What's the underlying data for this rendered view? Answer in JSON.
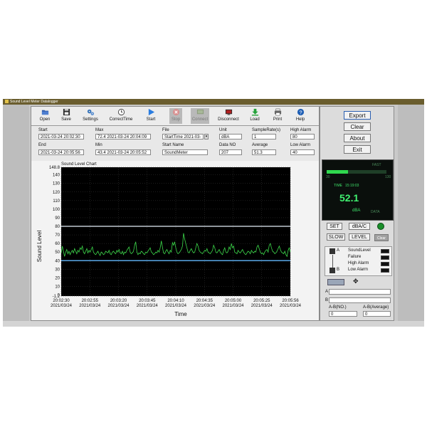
{
  "window": {
    "title": "Sound Level Meter Datalogger"
  },
  "toolbar": [
    {
      "label": "Open",
      "icon": "folder-icon"
    },
    {
      "label": "Save",
      "icon": "floppy-icon"
    },
    {
      "label": "Settings",
      "icon": "gears-icon"
    },
    {
      "label": "CorrectTime",
      "icon": "clock-icon"
    },
    {
      "label": "Start",
      "icon": "play-icon"
    },
    {
      "label": "Stop",
      "icon": "stop-icon",
      "disabled": true
    },
    {
      "label": "Connect",
      "icon": "connect-icon",
      "disabled": true
    },
    {
      "label": "Disconnect",
      "icon": "monitor-icon"
    },
    {
      "label": "Load",
      "icon": "download-arrow-icon"
    },
    {
      "label": "Print",
      "icon": "printer-icon"
    },
    {
      "label": "Help",
      "icon": "help-icon"
    }
  ],
  "info": {
    "start_label": "Start",
    "start_value": "2021-03-24  20:02:30",
    "end_label": "End",
    "end_value": "2021-03-24  20:05:56",
    "max_label": "Max",
    "max_value": "72.4 2021-03-24  20:04:09",
    "min_label": "Min",
    "min_value": "43.4 2021-03-24  20:05:52",
    "file_label": "File",
    "file_value": "StartTime 2021-03-",
    "start_name_label": "Start Name",
    "start_name_value": "SoundMeter",
    "unit_label": "Unit",
    "unit_value": "dBA",
    "data_no_label": "Data NO",
    "data_no_value": "207",
    "sample_rate_label": "SampleRate(s)",
    "sample_rate_value": "1",
    "average_label": "Average",
    "average_value": "51.3",
    "high_alarm_label": "High Alarm",
    "high_alarm_value": "80",
    "low_alarm_label": "Low Alarm",
    "low_alarm_value": "40"
  },
  "side": {
    "export": "Export",
    "clear": "Clear",
    "about": "About",
    "exit": "Exit",
    "set": "SET",
    "dba_c": "dBA/C",
    "slow": "SLOW",
    "level": "LEVEL",
    "clear_small": "Clear"
  },
  "meter": {
    "top_label": "FAST",
    "scale_left": "30",
    "scale_right": "130",
    "time_label": "TIME",
    "time_value": "15:19:03",
    "value": "52.1",
    "unit": "dBA",
    "mode": "DATA"
  },
  "legend": {
    "a_label": "A",
    "b_label": "B",
    "items": [
      {
        "label": "SoundLevel",
        "color": "#2bd84a"
      },
      {
        "label": "Failure",
        "color": "#e03030"
      },
      {
        "label": "High Alarm",
        "color": "#e06a6a"
      },
      {
        "label": "Low Alarm",
        "color": "#5fa8e8"
      }
    ]
  },
  "ab": {
    "a_label": "A",
    "b_label": "B",
    "a_no_label": "A-B(NO.)",
    "a_no_value": "0",
    "a_avg_label": "A-B(Average)",
    "a_avg_value": "0"
  },
  "chart_data": {
    "type": "line",
    "title": "Sound Level Chart",
    "xlabel": "Time",
    "ylabel": "Sound Level",
    "ylim": [
      -1.2,
      148.8
    ],
    "y_ticks": [
      "148.8",
      "140",
      "130",
      "120",
      "110",
      "100",
      "90",
      "80",
      "70",
      "60",
      "50",
      "40",
      "30",
      "20",
      "10",
      "0",
      "-1.2"
    ],
    "x_ticks": [
      {
        "time": "20:02:30",
        "date": "2021/03/24"
      },
      {
        "time": "20:02:55",
        "date": "2021/03/24"
      },
      {
        "time": "20:03:20",
        "date": "2021/03/24"
      },
      {
        "time": "20:03:45",
        "date": "2021/03/24"
      },
      {
        "time": "20:04:10",
        "date": "2021/03/24"
      },
      {
        "time": "20:04:35",
        "date": "2021/03/24"
      },
      {
        "time": "20:05:00",
        "date": "2021/03/24"
      },
      {
        "time": "20:05:25",
        "date": "2021/03/24"
      },
      {
        "time": "20:05:56",
        "date": "2021/03/24"
      }
    ],
    "high_alarm": 80,
    "low_alarm": 40,
    "grid": true,
    "colors": {
      "background": "#000000",
      "line": "#3cd84a",
      "high": "#bfc7cf",
      "low": "#5aa7e6",
      "grid": "#3a3a3a"
    },
    "series": [
      {
        "name": "SoundLevel",
        "values": [
          49,
          57,
          51,
          45,
          50,
          53,
          48,
          51,
          47,
          50,
          52,
          49,
          54,
          51,
          48,
          52,
          50,
          55,
          53,
          57,
          50,
          48,
          51,
          54,
          49,
          52,
          50,
          53,
          56,
          50,
          48,
          47,
          49,
          51,
          48,
          46,
          50,
          49,
          47,
          48,
          51,
          50,
          49,
          52,
          48,
          47,
          50,
          51,
          49,
          48,
          52,
          50,
          53,
          49,
          48,
          51,
          47,
          50,
          49,
          52,
          54,
          56,
          50,
          48,
          49,
          51,
          58,
          62,
          50,
          47,
          49,
          48,
          51,
          50,
          48,
          47,
          50,
          49,
          51,
          53,
          55,
          50,
          49,
          47,
          48,
          50,
          49,
          52,
          50,
          55,
          63,
          56,
          49,
          48,
          51,
          53,
          50,
          48,
          52,
          50,
          61,
          58,
          62,
          55,
          50,
          48,
          49,
          51,
          53,
          57,
          72,
          65,
          60,
          55,
          50,
          49,
          52,
          54,
          51,
          49,
          50,
          55,
          60,
          57,
          52,
          50,
          49,
          48,
          50,
          52,
          51,
          54,
          50,
          49,
          48,
          50,
          52,
          58,
          55,
          50,
          49,
          51,
          53,
          50,
          48,
          47,
          52,
          55,
          50,
          49,
          51,
          56,
          53,
          60,
          55,
          57,
          50,
          49,
          48,
          52,
          50,
          49,
          51,
          53,
          50,
          48,
          47,
          49,
          51,
          50,
          48,
          52,
          50,
          49,
          51,
          50,
          56,
          58,
          54,
          50,
          48,
          49,
          47,
          50,
          52,
          53,
          50,
          58,
          60,
          55,
          51,
          50,
          48,
          49,
          51,
          54,
          57,
          53,
          50,
          49,
          48,
          51,
          47,
          45,
          52,
          55,
          50
        ]
      }
    ]
  }
}
